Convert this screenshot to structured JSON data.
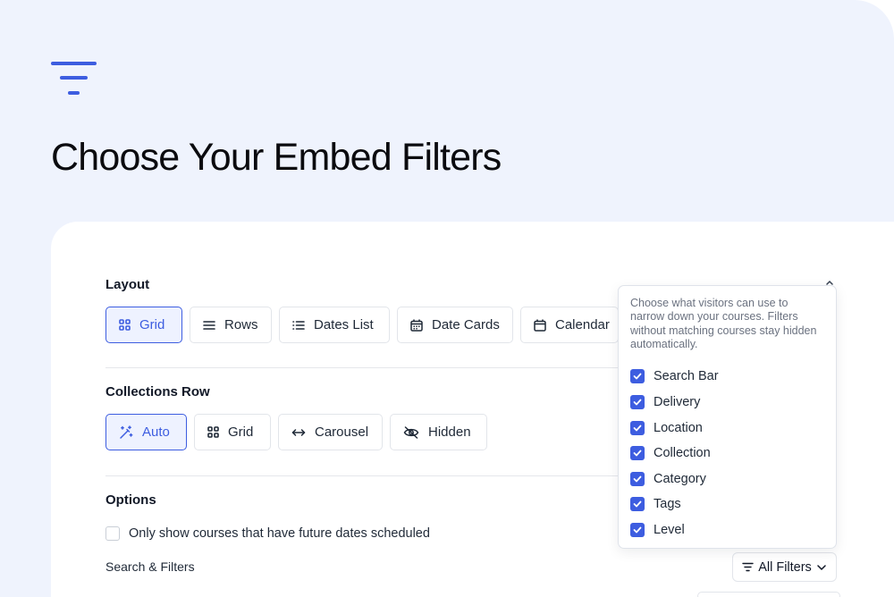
{
  "page": {
    "title": "Choose Your Embed Filters"
  },
  "layout": {
    "label": "Layout",
    "options": [
      {
        "label": "Grid",
        "icon": "grid-icon",
        "active": true
      },
      {
        "label": "Rows",
        "icon": "rows-icon",
        "active": false
      },
      {
        "label": "Dates List",
        "icon": "list-icon",
        "active": false
      },
      {
        "label": "Date Cards",
        "icon": "calendar-grid-icon",
        "active": false
      },
      {
        "label": "Calendar",
        "icon": "calendar-icon",
        "active": false
      }
    ]
  },
  "collections": {
    "label": "Collections Row",
    "options": [
      {
        "label": "Auto",
        "icon": "magic-wand-icon",
        "active": true
      },
      {
        "label": "Grid",
        "icon": "grid-icon",
        "active": false
      },
      {
        "label": "Carousel",
        "icon": "arrows-horizontal-icon",
        "active": false
      },
      {
        "label": "Hidden",
        "icon": "eye-off-icon",
        "active": false
      }
    ]
  },
  "options": {
    "label": "Options",
    "future_dates": {
      "label": "Only show courses that have future dates scheduled",
      "checked": false
    },
    "search_filters_label": "Search & Filters"
  },
  "filters_button": {
    "label": "All Filters",
    "icon": "filter-icon"
  },
  "dropdown": {
    "help": "Choose what visitors can use to narrow down your courses. Filters without matching courses stay hidden automatically.",
    "items": [
      {
        "label": "Search Bar",
        "checked": true
      },
      {
        "label": "Delivery",
        "checked": true
      },
      {
        "label": "Location",
        "checked": true
      },
      {
        "label": "Collection",
        "checked": true
      },
      {
        "label": "Category",
        "checked": true
      },
      {
        "label": "Tags",
        "checked": true
      },
      {
        "label": "Level",
        "checked": true
      }
    ]
  },
  "colors": {
    "accent": "#3d5de0",
    "background": "#eff3fd",
    "card": "#ffffff",
    "border": "#e2e5ea"
  }
}
